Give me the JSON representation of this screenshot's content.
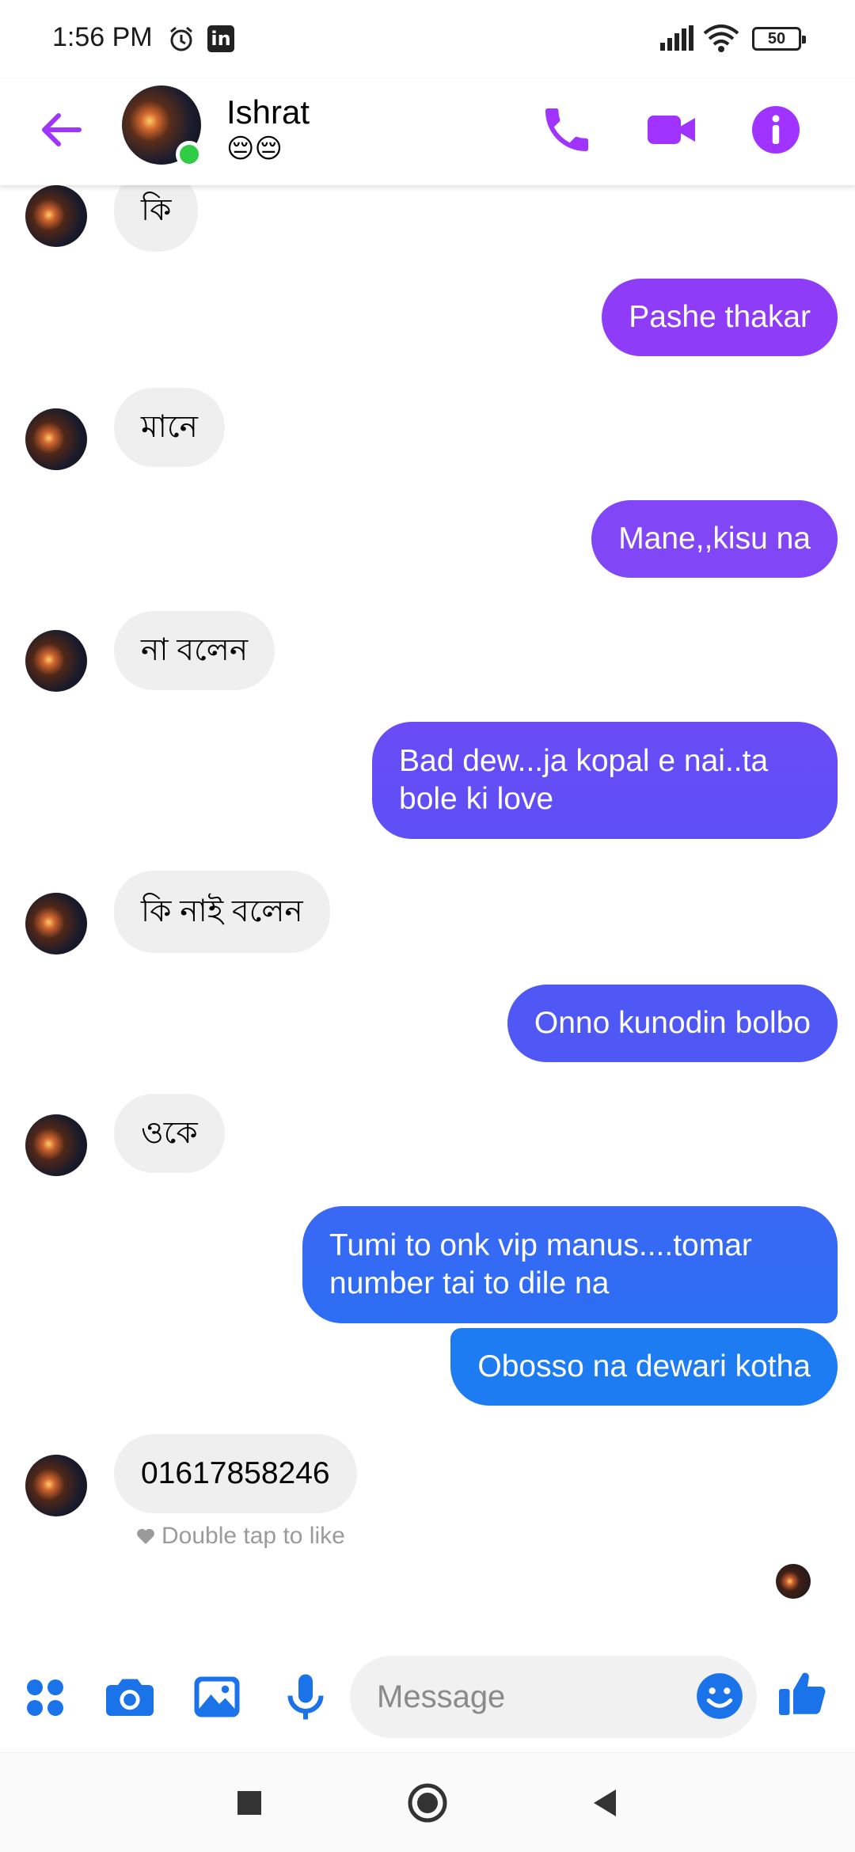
{
  "status_bar": {
    "time": "1:56 PM",
    "battery": "50",
    "icons": [
      "alarm-icon",
      "linkedin-icon",
      "signal-icon",
      "wifi-icon",
      "battery-icon"
    ]
  },
  "header": {
    "contact_name": "Ishrat",
    "contact_status": "😔😔",
    "icons": [
      "back-arrow-icon",
      "phone-icon",
      "video-camera-icon",
      "info-icon"
    ]
  },
  "messages": [
    {
      "dir": "in",
      "text": "কি"
    },
    {
      "dir": "out",
      "text": "Pashe thakar"
    },
    {
      "dir": "in",
      "text": "মানে"
    },
    {
      "dir": "out",
      "text": "Mane,,kisu na"
    },
    {
      "dir": "in",
      "text": "না বলেন"
    },
    {
      "dir": "out",
      "text": "Bad dew...ja kopal e nai..ta bole ki love"
    },
    {
      "dir": "in",
      "text": "কি নাই বলেন"
    },
    {
      "dir": "out",
      "text": "Onno kunodin bolbo"
    },
    {
      "dir": "in",
      "text": "ওকে"
    },
    {
      "dir": "out",
      "text": "Tumi to onk vip manus....tomar number tai to dile na"
    },
    {
      "dir": "out",
      "text": "Obosso na dewari kotha"
    },
    {
      "dir": "in",
      "text": "01617858246"
    }
  ],
  "hint": "Double tap to like",
  "composer": {
    "placeholder": "Message",
    "icons": [
      "menu-dots-icon",
      "camera-icon",
      "gallery-icon",
      "microphone-icon",
      "emoji-icon",
      "thumbs-up-icon"
    ]
  },
  "colors": {
    "accent_purple": "#a033ff",
    "bubble_top": "#8e3cf7",
    "bubble_mid": "#5f4ff6",
    "bubble_bottom": "#1e7cf2",
    "composer_blue": "#1a73e8",
    "online_green": "#31cc46",
    "incoming_bubble": "#efefef"
  }
}
